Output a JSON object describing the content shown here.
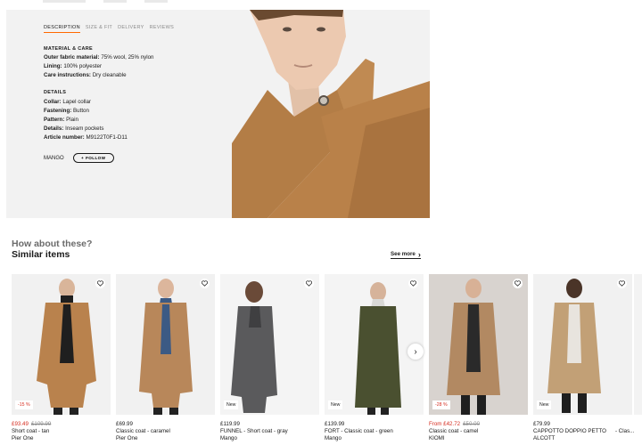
{
  "tabs": [
    "DESCRIPTION",
    "SIZE & FIT",
    "DELIVERY",
    "REVIEWS"
  ],
  "material": {
    "title": "MATERIAL & CARE",
    "rows": [
      {
        "label": "Outer fabric material:",
        "value": "75% wool, 25% nylon"
      },
      {
        "label": "Lining:",
        "value": "100% polyester"
      },
      {
        "label": "Care instructions:",
        "value": "Dry cleanable"
      }
    ]
  },
  "details": {
    "title": "DETAILS",
    "rows": [
      {
        "label": "Collar:",
        "value": "Lapel collar"
      },
      {
        "label": "Fastening:",
        "value": "Button"
      },
      {
        "label": "Pattern:",
        "value": "Plain"
      },
      {
        "label": "Details:",
        "value": "Inseam pockets"
      },
      {
        "label": "Article number:",
        "value": "M9122T0F1-D11"
      }
    ]
  },
  "brand": {
    "name": "MANGO",
    "follow_label": "FOLLOW",
    "follow_icon": "plus-icon"
  },
  "recommendations": {
    "subtitle": "How about these?",
    "title": "Similar items",
    "see_more": "See more",
    "products": [
      {
        "price": "£93.49",
        "old_price": "£109.99",
        "sale": true,
        "name": "Short coat - tan",
        "brand": "Pier One",
        "badge": "-15 %",
        "coat_color": "#b9824d",
        "bg": "#f1f1f1"
      },
      {
        "price": "£69.99",
        "old_price": "",
        "sale": false,
        "name": "Classic coat - caramel",
        "brand": "Pier One",
        "badge": "",
        "coat_color": "#b8875a",
        "bg": "#f1f1f1"
      },
      {
        "price": "£119.99",
        "old_price": "",
        "sale": false,
        "name": "FUNNEL - Short coat - gray",
        "brand": "Mango",
        "badge": "New",
        "coat_color": "#5a5a5c",
        "bg": "#f4f4f4"
      },
      {
        "price": "£139.99",
        "old_price": "",
        "sale": false,
        "name": "FORT - Classic coat - green",
        "brand": "Mango",
        "badge": "New",
        "coat_color": "#4a5030",
        "bg": "#f4f4f4"
      },
      {
        "price": "£42.72",
        "price_prefix": "From",
        "old_price": "£50.00",
        "sale": true,
        "name": "Classic coat - camel",
        "brand": "KIOMI",
        "badge": "-28 %",
        "coat_color": "#b28962",
        "bg": "#d8d3cf"
      },
      {
        "price": "£79.99",
        "old_price": "",
        "sale": false,
        "name": "CAPPOTTO DOPPIO PETTO",
        "brand": "ALCOTT",
        "badge": "New",
        "coat_color": "#c2a076",
        "bg": "#f1f1f1"
      }
    ],
    "partial_name": "- Clas..."
  },
  "colors": {
    "accent": "#ff6900",
    "sale": "#d62d20",
    "panel_bg": "#f2f2f2"
  }
}
